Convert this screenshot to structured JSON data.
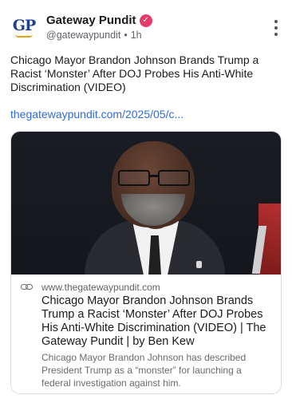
{
  "account": {
    "avatar_text": "GP",
    "name": "Gateway Pundit",
    "handle": "@gatewaypundit",
    "separator": "•",
    "time": "1h"
  },
  "post": {
    "text": "Chicago Mayor Brandon Johnson Brands Trump a Racist ‘Monster’ After DOJ Probes His Anti-White Discrimination (VIDEO)",
    "link_text": "thegatewaypundit.com/2025/05/c..."
  },
  "card": {
    "domain": "www.thegatewaypundit.com",
    "title": "Chicago Mayor Brandon Johnson Brands Trump a Racist ‘Monster’ After DOJ Probes His Anti-White Discrimination (VIDEO) | The Gateway Pundit | by Ben Kew",
    "description": "Chicago Mayor Brandon Johnson has described President Trump as a “monster” for launching a federal investigation against him."
  },
  "colors": {
    "link": "#2f6bd8",
    "verified": "#e63b6a",
    "brand_blue": "#1f3f8f",
    "brand_gold": "#e8a11c"
  },
  "icons": {
    "verified": "verified-badge-icon",
    "more": "more-vertical-icon",
    "link": "link-icon"
  }
}
